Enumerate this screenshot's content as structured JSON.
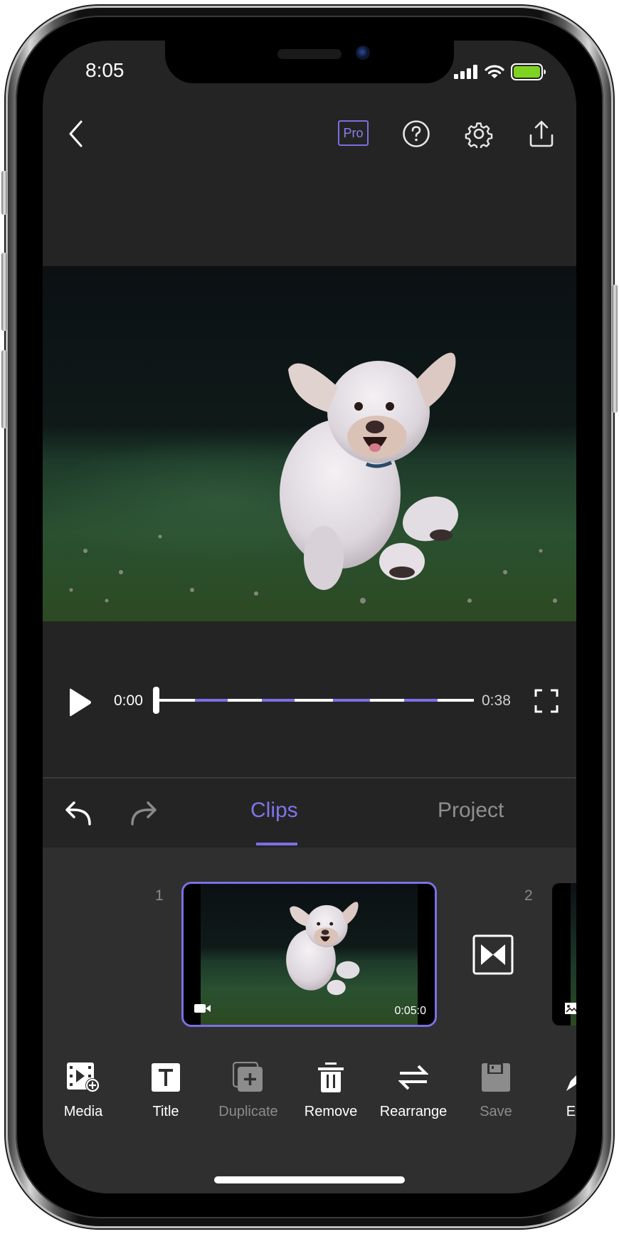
{
  "status_bar": {
    "time": "8:05",
    "signal_icon": "cellular-signal-icon",
    "wifi_icon": "wifi-icon",
    "battery_icon": "battery-icon",
    "battery_color": "#7ed321"
  },
  "header": {
    "back_icon": "chevron-left-icon",
    "pro_label": "Pro",
    "help_icon": "question-circle-icon",
    "settings_icon": "gear-icon",
    "share_icon": "share-upload-icon"
  },
  "preview": {
    "description": "White curly-haired dog running on grass"
  },
  "player": {
    "current_time": "0:00",
    "total_time": "0:38",
    "progress_fraction": 0.0,
    "transition_markers_fraction": [
      [
        0.117,
        0.221
      ],
      [
        0.329,
        0.432
      ],
      [
        0.554,
        0.671
      ],
      [
        0.779,
        0.885
      ]
    ],
    "play_icon": "play-icon",
    "fullscreen_icon": "fullscreen-icon"
  },
  "tabs": {
    "undo_icon": "undo-icon",
    "redo_icon": "redo-icon",
    "items": [
      {
        "label": "Clips",
        "active": true
      },
      {
        "label": "Project",
        "active": false
      }
    ]
  },
  "clips": [
    {
      "number": "1",
      "duration": "0:05:0",
      "type_icon": "video-camera-icon",
      "selected": true
    },
    {
      "number": "2",
      "type_icon": "image-icon",
      "selected": false
    }
  ],
  "transition": {
    "icon": "bowtie-transition-icon"
  },
  "toolbar": {
    "items": [
      {
        "label": "Media",
        "icon": "media-add-icon",
        "enabled": true
      },
      {
        "label": "Title",
        "icon": "title-text-icon",
        "enabled": true
      },
      {
        "label": "Duplicate",
        "icon": "duplicate-icon",
        "enabled": false
      },
      {
        "label": "Remove",
        "icon": "trash-icon",
        "enabled": true
      },
      {
        "label": "Rearrange",
        "icon": "rearrange-arrows-icon",
        "enabled": true
      },
      {
        "label": "Save",
        "icon": "floppy-disk-icon",
        "enabled": false
      },
      {
        "label": "Edit",
        "icon": "pencil-icon",
        "enabled": true
      }
    ]
  },
  "colors": {
    "accent": "#7b6fe4",
    "background": "#242424",
    "panel": "#2f2f2f"
  }
}
